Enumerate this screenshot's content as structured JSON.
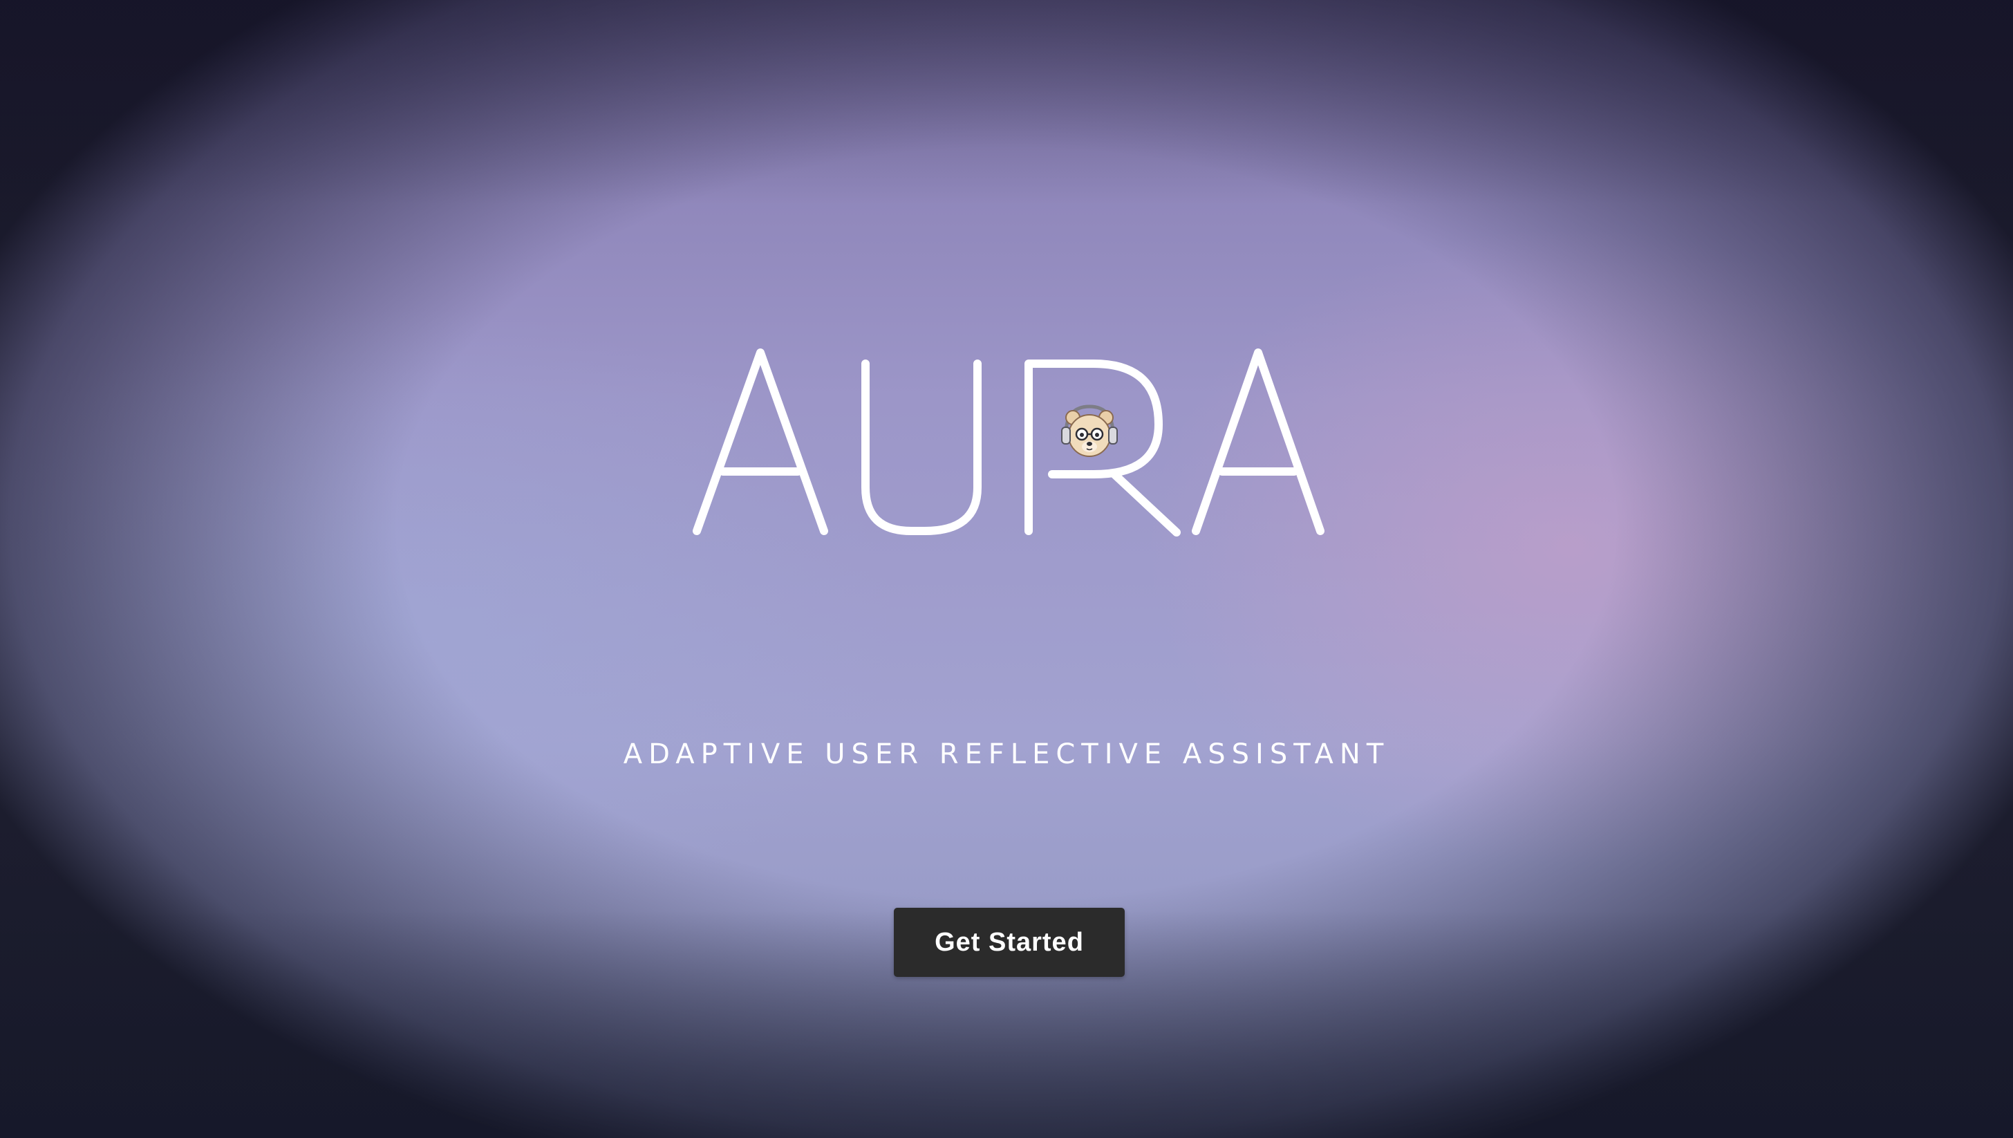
{
  "hero": {
    "logo_text": "AURA",
    "mascot_icon": "bear-with-headphones-icon",
    "tagline": "ADAPTIVE USER REFLECTIVE ASSISTANT",
    "cta_label": "Get Started"
  },
  "colors": {
    "text": "#ffffff",
    "button_bg": "#2b2b2b",
    "background_top": "#8479ae",
    "background_accent_pink": "#cda0c8"
  }
}
